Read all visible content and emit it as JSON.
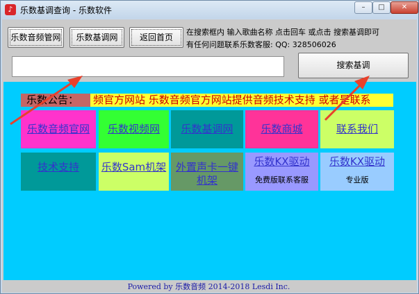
{
  "window": {
    "title": "乐数基调查询 - 乐数软件",
    "controls": {
      "minimize": "–",
      "maximize": "□",
      "close": "✕"
    }
  },
  "toolbar": {
    "buttons": [
      "乐数音频管网",
      "乐数基调网",
      "返回首页"
    ],
    "info_line1": "在搜索框内 输入歌曲名称 点击回车 或点击 搜索基调即可",
    "info_line2": "有任何问题联系乐数客服: QQ: 328506026",
    "search_input_value": "",
    "search_button": "搜索基调"
  },
  "notice": {
    "label": "乐数公告：",
    "text": "频官方网站  乐数音频官方网站提供音频技术支持  或者是联系"
  },
  "tiles": {
    "row1": [
      {
        "label": "乐数音频官网",
        "bg": "#ff33cc",
        "color": "#3333cc"
      },
      {
        "label": "乐数视频网",
        "bg": "#33ff33",
        "color": "#3333cc"
      },
      {
        "label": "乐数基调网",
        "bg": "#009999",
        "color": "#3333cc"
      },
      {
        "label": "乐数商城",
        "bg": "#ff3399",
        "color": "#3333cc"
      },
      {
        "label": "联系我们",
        "bg": "#ccff66",
        "color": "#3333cc"
      }
    ],
    "row2": [
      {
        "label": "技术支持",
        "bg": "#009999",
        "color": "#3333cc"
      },
      {
        "label": "乐数Sam机架",
        "bg": "#ccff66",
        "color": "#3333cc"
      },
      {
        "label": "外置声卡一键机架",
        "bg": "#669966",
        "color": "#3333cc"
      },
      {
        "label": "乐数KX驱动",
        "sub": "免费版联系客服",
        "bg": "#9999ff",
        "color": "#3333cc"
      },
      {
        "label": "乐数KX驱动",
        "sub": "专业版",
        "bg": "#99ccff",
        "color": "#3333cc"
      }
    ]
  },
  "footer": {
    "text": "Powered by 乐数音频  2014-2018 Lesdi Inc."
  },
  "colors": {
    "content_bg": "#00ccff",
    "notice_bg": "#ffff33",
    "arrow": "#e8412c"
  }
}
